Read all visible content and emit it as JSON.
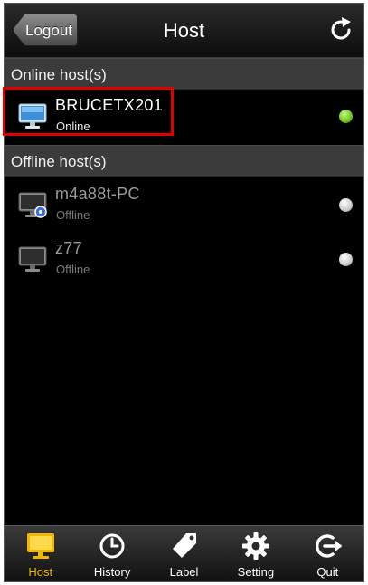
{
  "header": {
    "back_label": "Logout",
    "title": "Host"
  },
  "sections": {
    "online_title": "Online host(s)",
    "offline_title": "Offline host(s)"
  },
  "online_hosts": [
    {
      "name": "BRUCETX201",
      "status": "Online",
      "indicator": "#6cc414"
    }
  ],
  "offline_hosts": [
    {
      "name": "m4a88t-PC",
      "status": "Offline",
      "indicator": "#c9c9c9"
    },
    {
      "name": "z77",
      "status": "Offline",
      "indicator": "#c9c9c9"
    }
  ],
  "tabs": [
    {
      "label": "Host",
      "icon": "monitor-icon",
      "active": true
    },
    {
      "label": "History",
      "icon": "clock-icon",
      "active": false
    },
    {
      "label": "Label",
      "icon": "tag-icon",
      "active": false
    },
    {
      "label": "Setting",
      "icon": "gear-icon",
      "active": false
    },
    {
      "label": "Quit",
      "icon": "exit-icon",
      "active": false
    }
  ],
  "colors": {
    "accent": "#f0b800",
    "highlight_border": "#e00000"
  }
}
